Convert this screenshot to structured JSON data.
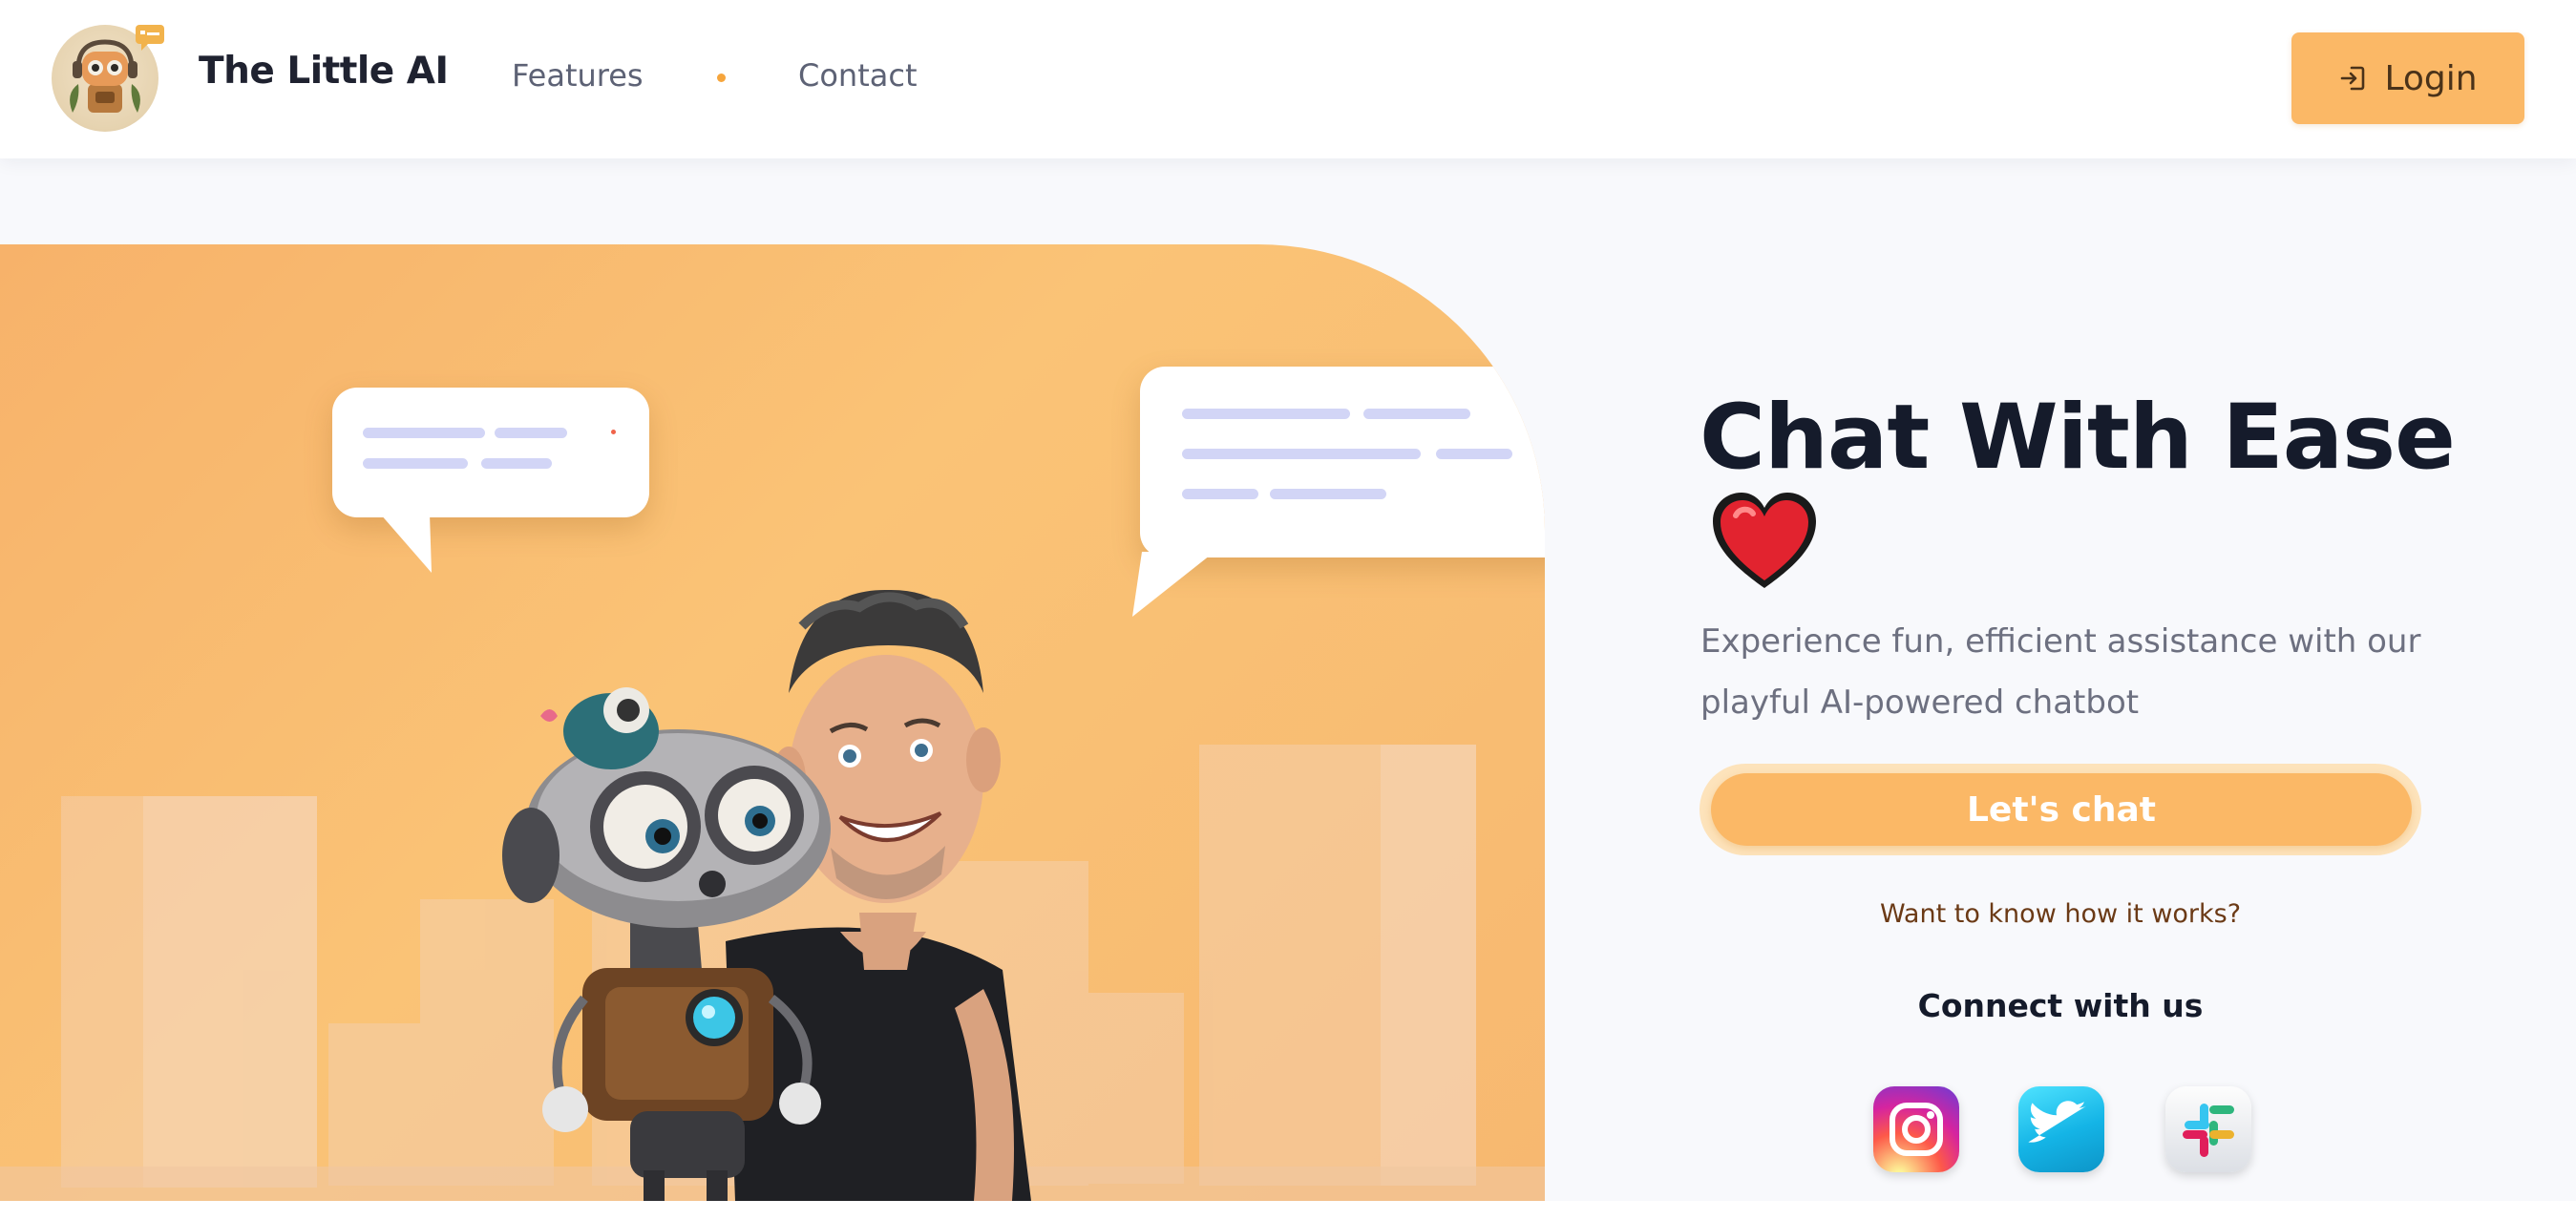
{
  "header": {
    "brand": "The Little AI",
    "logo_icon": "robot-logo-icon",
    "nav": [
      {
        "label": "Features"
      },
      {
        "label": "Contact"
      }
    ],
    "login_label": "Login",
    "login_icon": "login-arrow-icon"
  },
  "hero": {
    "illustration": "robot-and-man-chat-illustration",
    "headline": "Chat With Ease",
    "headline_emoji": "red-heart",
    "subtitle": "Experience fun, efficient assistance with our playful AI-powered chatbot",
    "cta_label": "Let's chat",
    "how_link": "Want to know how it works?",
    "connect_title": "Connect with us",
    "social": [
      {
        "icon": "instagram-icon"
      },
      {
        "icon": "twitter-icon"
      },
      {
        "icon": "slack-icon"
      }
    ]
  },
  "colors": {
    "accent": "#fbb866",
    "hero_bg": "#fac376",
    "headline": "#151b2b",
    "page_bg": "#f8f9fc"
  }
}
